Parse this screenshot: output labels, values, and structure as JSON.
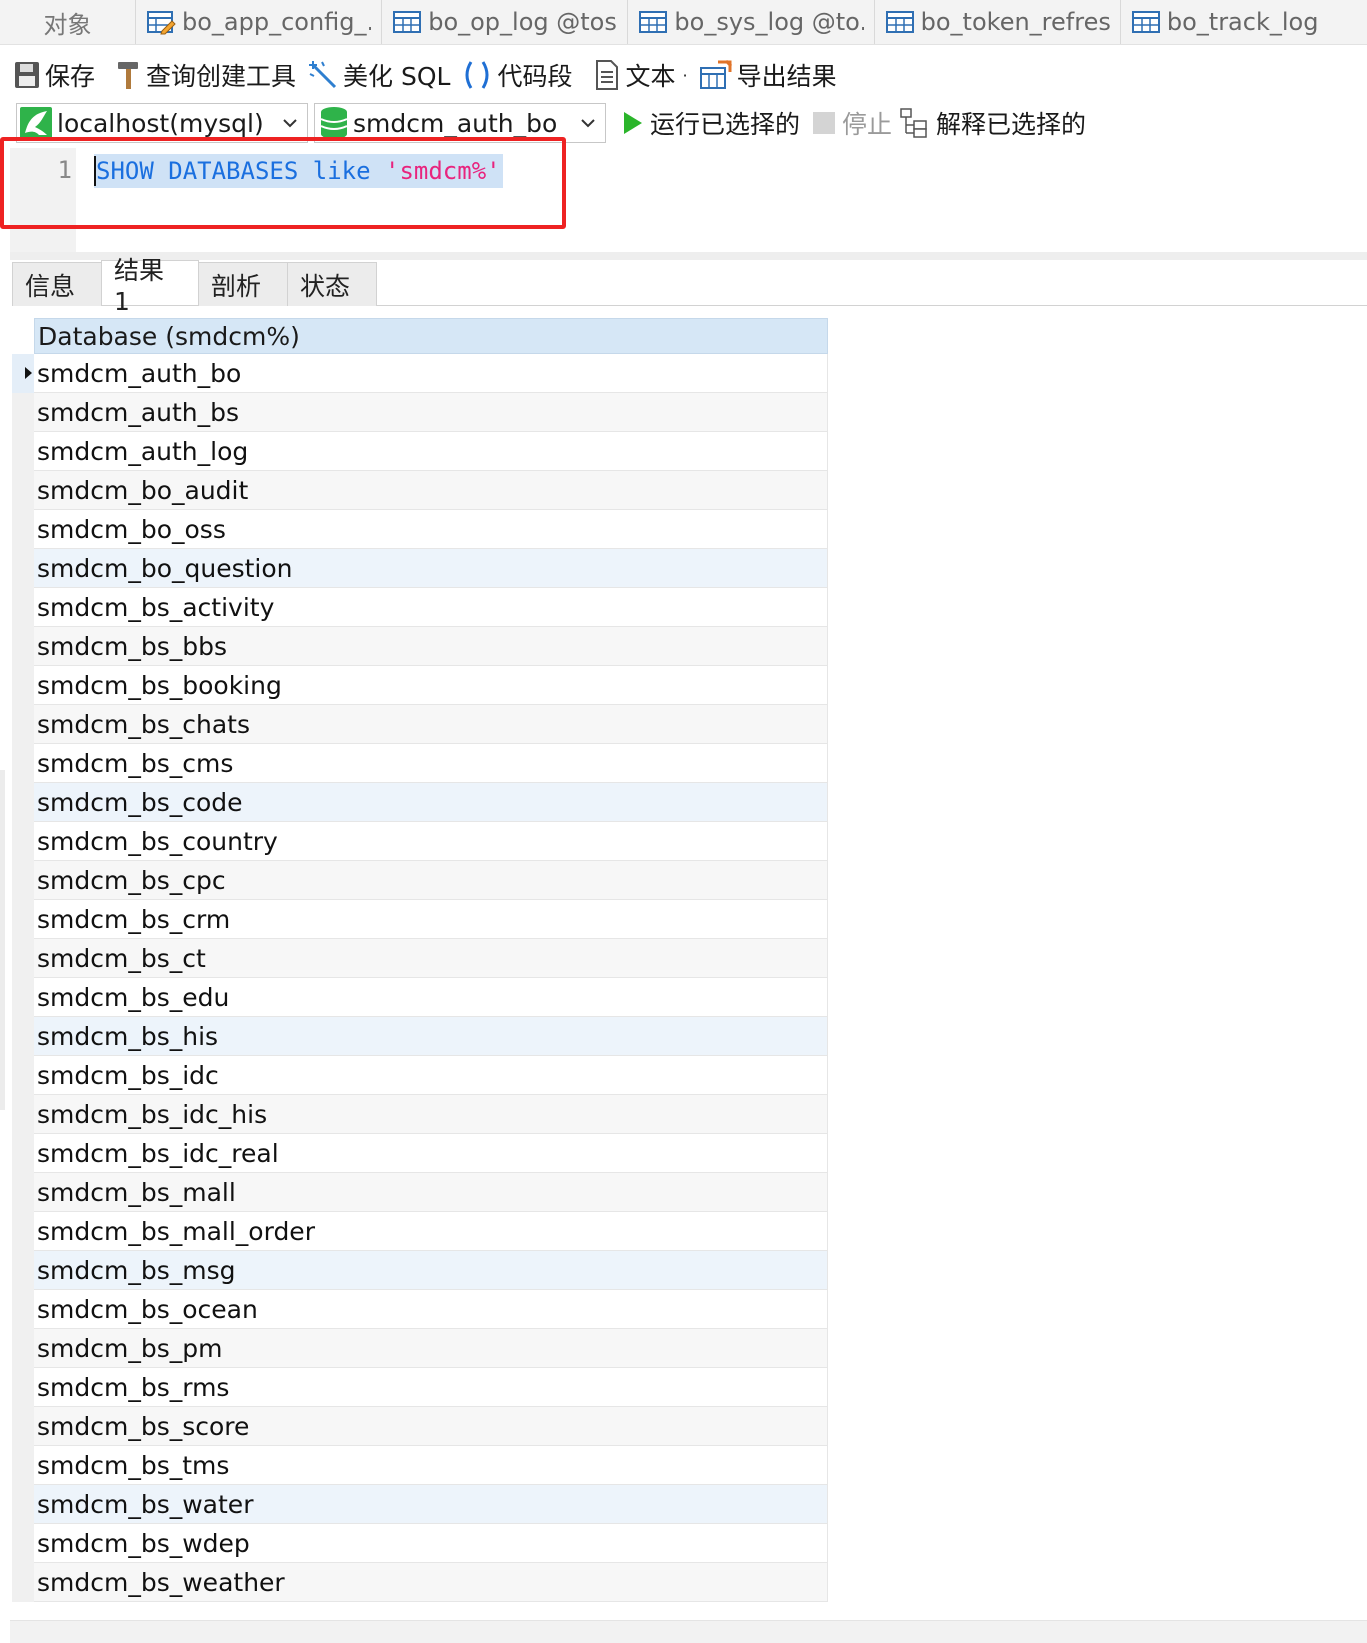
{
  "tabs": {
    "object_label": "对象",
    "items": [
      {
        "label": "bo_app_config_...",
        "icon": "table-edit-icon"
      },
      {
        "label": "bo_op_log @tos...",
        "icon": "table-icon"
      },
      {
        "label": "bo_sys_log @to...",
        "icon": "table-icon"
      },
      {
        "label": "bo_token_refres...",
        "icon": "table-icon"
      },
      {
        "label": "bo_track_log",
        "icon": "table-icon"
      }
    ]
  },
  "toolbar": {
    "save": "保存",
    "query_builder": "查询创建工具",
    "beautify": "美化 SQL",
    "snippet": "代码段",
    "text": "文本",
    "export": "导出结果"
  },
  "connection": {
    "host": "localhost(mysql)",
    "database": "smdcm_auth_bo",
    "run_selected": "运行已选择的",
    "stop": "停止",
    "explain_selected": "解释已选择的"
  },
  "editor": {
    "line_number": "1",
    "kw1": "SHOW",
    "kw2": "DATABASES",
    "kw3": "like",
    "str": "'smdcm%'"
  },
  "result_tabs": {
    "info": "信息",
    "result1": "结果 1",
    "profile": "剖析",
    "status": "状态"
  },
  "grid": {
    "column": "Database (smdcm%)",
    "rows": [
      "smdcm_auth_bo",
      "smdcm_auth_bs",
      "smdcm_auth_log",
      "smdcm_bo_audit",
      "smdcm_bo_oss",
      "smdcm_bo_question",
      "smdcm_bs_activity",
      "smdcm_bs_bbs",
      "smdcm_bs_booking",
      "smdcm_bs_chats",
      "smdcm_bs_cms",
      "smdcm_bs_code",
      "smdcm_bs_country",
      "smdcm_bs_cpc",
      "smdcm_bs_crm",
      "smdcm_bs_ct",
      "smdcm_bs_edu",
      "smdcm_bs_his",
      "smdcm_bs_idc",
      "smdcm_bs_idc_his",
      "smdcm_bs_idc_real",
      "smdcm_bs_mall",
      "smdcm_bs_mall_order",
      "smdcm_bs_msg",
      "smdcm_bs_ocean",
      "smdcm_bs_pm",
      "smdcm_bs_rms",
      "smdcm_bs_score",
      "smdcm_bs_tms",
      "smdcm_bs_water",
      "smdcm_bs_wdep",
      "smdcm_bs_weather"
    ],
    "current_row": 0,
    "selected_rows": [
      5,
      11,
      17,
      23,
      29
    ]
  },
  "colors": {
    "highlight_box": "#ee2222",
    "keyword": "#1a6fdf",
    "string": "#e8247e",
    "header_bg": "#d6e7f6",
    "run_green": "#2bb52b"
  }
}
